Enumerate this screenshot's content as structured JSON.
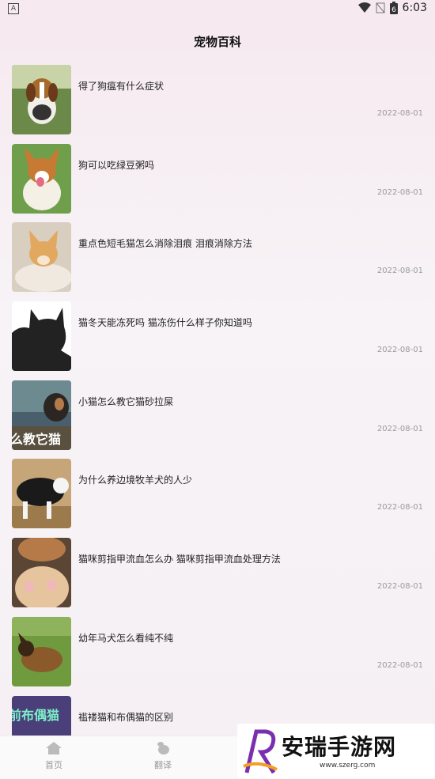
{
  "status": {
    "left_icon": "A",
    "time": "6:03",
    "battery": "6"
  },
  "header": {
    "title": "宠物百科"
  },
  "articles": [
    {
      "title": "得了狗瘟有什么症状",
      "date": "2022-08-01"
    },
    {
      "title": "狗可以吃绿豆粥吗",
      "date": "2022-08-01"
    },
    {
      "title": "重点色短毛猫怎么消除泪痕 泪痕消除方法",
      "date": "2022-08-01"
    },
    {
      "title": "猫冬天能冻死吗 猫冻伤什么样子你知道吗",
      "date": "2022-08-01"
    },
    {
      "title": "小猫怎么教它猫砂拉屎",
      "date": "2022-08-01",
      "thumb_text": "么教它猫"
    },
    {
      "title": "为什么养边境牧羊犬的人少",
      "date": "2022-08-01"
    },
    {
      "title": "猫咪剪指甲流血怎么办 猫咪剪指甲流血处理方法",
      "date": "2022-08-01"
    },
    {
      "title": "幼年马犬怎么看纯不纯",
      "date": "2022-08-01"
    },
    {
      "title": "褴褛猫和布偶猫的区别",
      "date": "",
      "thumb_text": "前布偶猫"
    }
  ],
  "nav": {
    "home": "首页",
    "translate": "翻译"
  },
  "watermark": {
    "title": "安瑞手游网",
    "url": "www.szerg.com"
  }
}
